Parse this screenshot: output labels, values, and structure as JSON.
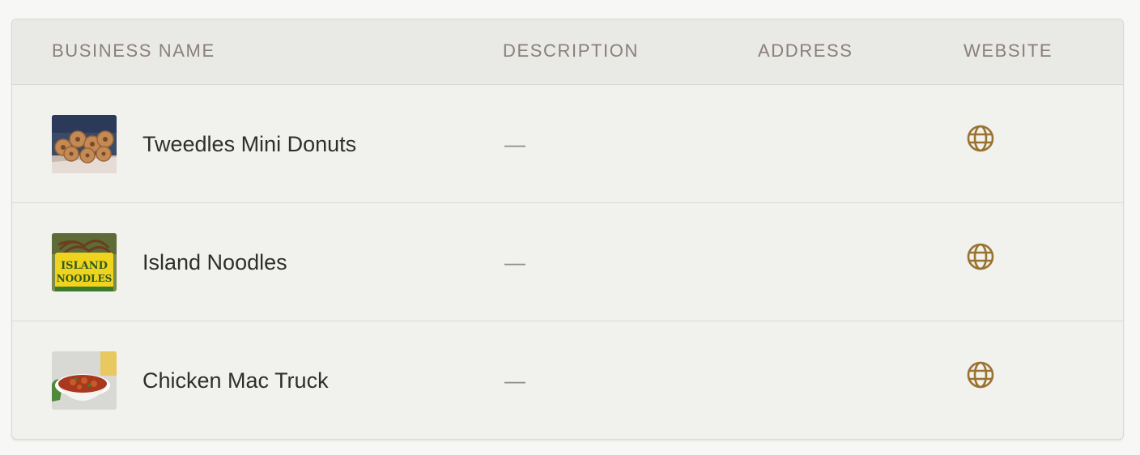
{
  "table": {
    "columns": {
      "business_name": "BUSINESS NAME",
      "description": "DESCRIPTION",
      "address": "ADDRESS",
      "website": "WEBSITE"
    },
    "rows": [
      {
        "name": "Tweedles Mini Donuts",
        "description": "—",
        "address": "",
        "website_icon": "globe-icon",
        "thumbnail": "donuts-photo"
      },
      {
        "name": "Island Noodles",
        "description": "—",
        "address": "",
        "website_icon": "globe-icon",
        "thumbnail": "noodles-photo"
      },
      {
        "name": "Chicken Mac Truck",
        "description": "—",
        "address": "",
        "website_icon": "globe-icon",
        "thumbnail": "mac-bowl-photo"
      }
    ]
  },
  "colors": {
    "accent": "#9a7230",
    "header_text": "#8a7f7c",
    "body_text": "#2e2e2e"
  }
}
